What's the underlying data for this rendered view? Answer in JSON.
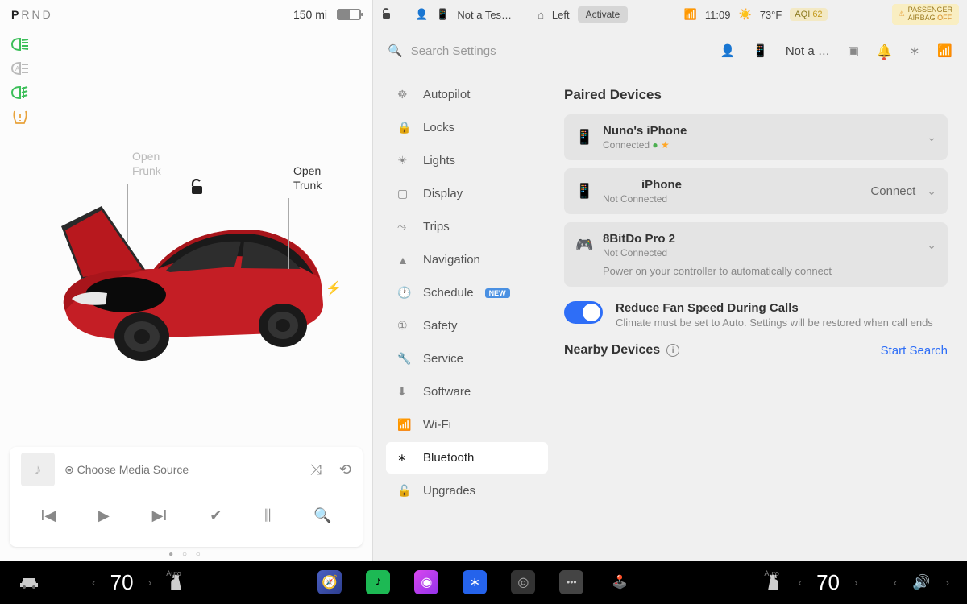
{
  "leftPanel": {
    "gear": {
      "p": "P",
      "r": "R",
      "n": "N",
      "d": "D",
      "active": "P"
    },
    "range": "150 mi",
    "labels": {
      "frunk_l1": "Open",
      "frunk_l2": "Frunk",
      "trunk_l1": "Open",
      "trunk_l2": "Trunk"
    },
    "media": {
      "source": "Choose Media Source"
    }
  },
  "topStatus": {
    "profile": "Not a Tes…",
    "homelink": "Left",
    "activate": "Activate",
    "time": "11:09",
    "temp": "73°F",
    "aqi_label": "AQI",
    "aqi_value": "62",
    "airbag_l1": "PASSENGER",
    "airbag_l2": "AIRBAG",
    "airbag_off": "OFF"
  },
  "settingsHeader": {
    "search_placeholder": "Search Settings",
    "profile": "Not a …"
  },
  "nav": {
    "autopilot": "Autopilot",
    "locks": "Locks",
    "lights": "Lights",
    "display": "Display",
    "trips": "Trips",
    "navigation": "Navigation",
    "schedule": "Schedule",
    "schedule_badge": "NEW",
    "safety": "Safety",
    "service": "Service",
    "software": "Software",
    "wifi": "Wi-Fi",
    "bluetooth": "Bluetooth",
    "upgrades": "Upgrades"
  },
  "content": {
    "paired_title": "Paired Devices",
    "devices": [
      {
        "name": "Nuno's iPhone",
        "status": "Connected"
      },
      {
        "name": "iPhone",
        "status": "Not Connected",
        "action": "Connect"
      },
      {
        "name": "8BitDo Pro 2",
        "status": "Not Connected",
        "hint": "Power on your controller to automatically connect"
      }
    ],
    "toggle": {
      "title": "Reduce Fan Speed During Calls",
      "desc": "Climate must be set to Auto. Settings will be restored when call ends"
    },
    "nearby_title": "Nearby Devices",
    "start_search": "Start Search"
  },
  "bottomBar": {
    "temp_left": "70",
    "temp_right": "70",
    "auto": "Auto"
  }
}
